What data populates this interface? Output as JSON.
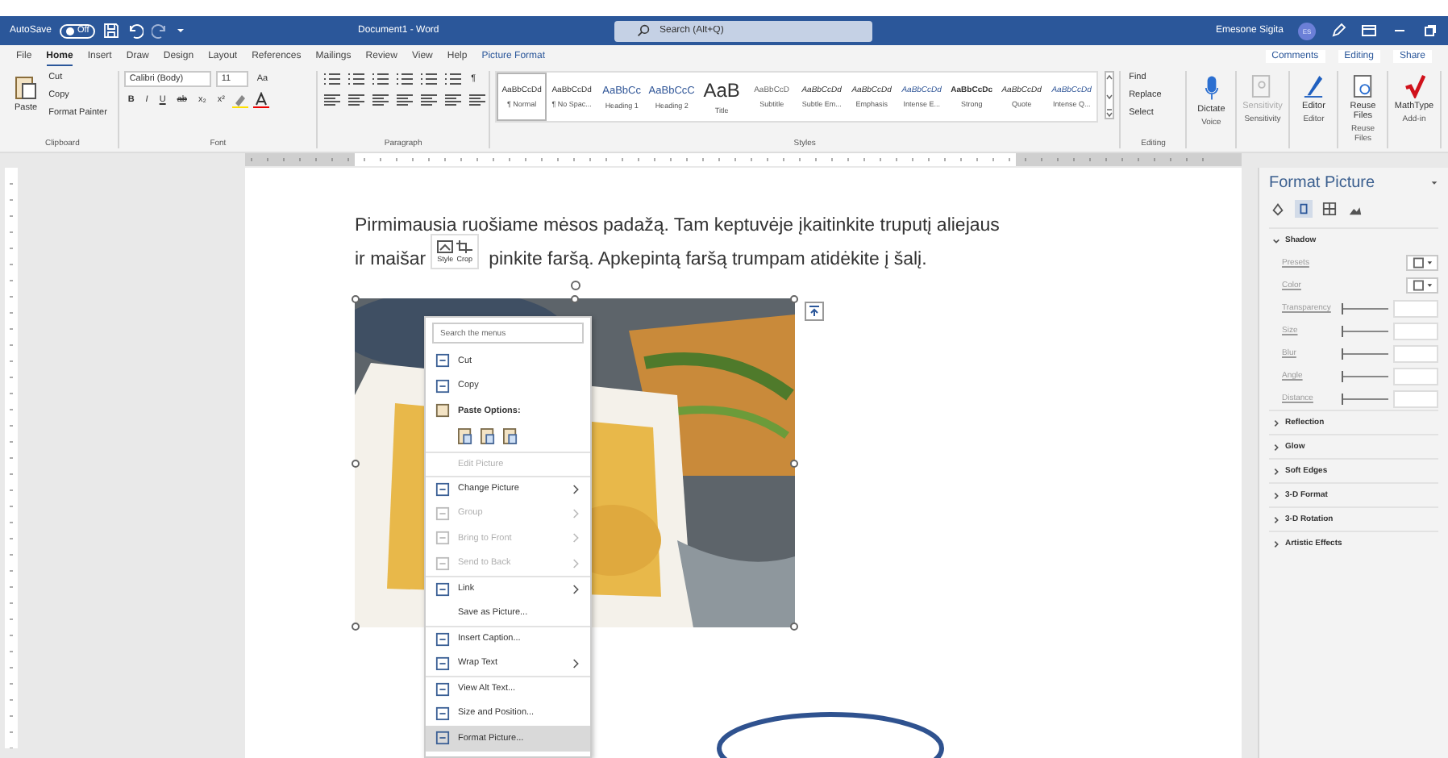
{
  "title_bar": {
    "autosave_label": "AutoSave",
    "autosave_on": false,
    "autosave_state": "Off",
    "document_title": "Document1 - Word",
    "search_placeholder": "Search (Alt+Q)",
    "user_name": "Emesone Sigita",
    "user_initials": "ES"
  },
  "tabs": [
    {
      "label": "File",
      "selected": false
    },
    {
      "label": "Home",
      "selected": true
    },
    {
      "label": "Insert",
      "selected": false
    },
    {
      "label": "Draw",
      "selected": false
    },
    {
      "label": "Design",
      "selected": false
    },
    {
      "label": "Layout",
      "selected": false
    },
    {
      "label": "References",
      "selected": false
    },
    {
      "label": "Mailings",
      "selected": false
    },
    {
      "label": "Review",
      "selected": false
    },
    {
      "label": "View",
      "selected": false
    },
    {
      "label": "Help",
      "selected": false
    },
    {
      "label": "Picture Format",
      "selected": false,
      "kind": "contextual"
    }
  ],
  "actions": {
    "comments": "Comments",
    "editing": "Editing",
    "share": "Share"
  },
  "ribbon": {
    "clipboard": {
      "paste": "Paste",
      "cut": "Cut",
      "copy": "Copy",
      "format_painter": "Format Painter",
      "label": "Clipboard"
    },
    "font": {
      "name": "Calibri (Body)",
      "size": "11",
      "case": "Aa",
      "format_buttons": [
        "B",
        "I",
        "U",
        "ab",
        "x₂",
        "x²"
      ],
      "label": "Font"
    },
    "paragraph": {
      "pilcrow": "¶",
      "label": "Paragraph"
    },
    "styles": {
      "items": [
        {
          "preview": "AaBbCcDd",
          "name": "¶ Normal",
          "selected": true,
          "kind": "normal"
        },
        {
          "preview": "AaBbCcDd",
          "name": "¶ No Spac...",
          "selected": false,
          "kind": "normal"
        },
        {
          "preview": "AaBbCc",
          "name": "Heading 1",
          "selected": false,
          "kind": "heading"
        },
        {
          "preview": "AaBbCcC",
          "name": "Heading 2",
          "selected": false,
          "kind": "heading"
        },
        {
          "preview": "AaB",
          "name": "Title",
          "selected": false,
          "kind": "title"
        },
        {
          "preview": "AaBbCcD",
          "name": "Subtitle",
          "selected": false,
          "kind": "subtitle"
        },
        {
          "preview": "AaBbCcDd",
          "name": "Subtle Em...",
          "selected": false,
          "kind": "emphasis"
        },
        {
          "preview": "AaBbCcDd",
          "name": "Emphasis",
          "selected": false,
          "kind": "emphasis"
        },
        {
          "preview": "AaBbCcDd",
          "name": "Intense E...",
          "selected": false,
          "kind": "intense"
        },
        {
          "preview": "AaBbCcDc",
          "name": "Strong",
          "selected": false,
          "kind": "strong"
        },
        {
          "preview": "AaBbCcDd",
          "name": "Quote",
          "selected": false,
          "kind": "emphasis"
        },
        {
          "preview": "AaBbCcDd",
          "name": "Intense Q...",
          "selected": false,
          "kind": "intense"
        }
      ],
      "label": "Styles"
    },
    "editing": {
      "find": "Find",
      "replace": "Replace",
      "select": "Select",
      "label": "Editing"
    },
    "voice": {
      "button": "Dictate",
      "label": "Voice"
    },
    "sensitivity": {
      "button": "Sensitivity",
      "label": "Sensitivity",
      "disabled": true
    },
    "editor": {
      "button": "Editor",
      "label": "Editor"
    },
    "reuse": {
      "button": "Reuse Files",
      "label": "Reuse Files"
    },
    "addin": {
      "button": "MathType",
      "label": "Add-in"
    }
  },
  "document": {
    "line_1": "Pirmimausia ruošiame mėsos padažą. Tam keptuvėje įkaitinkite truputį aliejaus",
    "line_2_start": "ir maišar",
    "line_2_end": "pinkite faršą. Apkepintą faršą trumpam atidėkite į šalį."
  },
  "mini_toolbar": {
    "style": "Style",
    "crop": "Crop"
  },
  "context_menu": {
    "search_placeholder": "Search the menus",
    "items": [
      {
        "kind": "item",
        "label": "Cut",
        "disabled": false,
        "submenu": false,
        "selected": false,
        "has_icon": true
      },
      {
        "kind": "item",
        "label": "Copy",
        "disabled": false,
        "submenu": false,
        "selected": false,
        "has_icon": true
      },
      {
        "kind": "header",
        "label": "Paste Options:",
        "disabled": false,
        "submenu": false,
        "selected": false,
        "has_icon": true
      },
      {
        "kind": "paste-options"
      },
      {
        "kind": "item",
        "label": "Edit Picture",
        "disabled": true,
        "submenu": false,
        "selected": false,
        "has_icon": false
      },
      {
        "kind": "item",
        "label": "Change Picture",
        "disabled": false,
        "submenu": true,
        "selected": false,
        "has_icon": true
      },
      {
        "kind": "item",
        "label": "Group",
        "disabled": true,
        "submenu": true,
        "selected": false,
        "has_icon": true
      },
      {
        "kind": "item",
        "label": "Bring to Front",
        "disabled": true,
        "submenu": true,
        "selected": false,
        "has_icon": true
      },
      {
        "kind": "item",
        "label": "Send to Back",
        "disabled": true,
        "submenu": true,
        "selected": false,
        "has_icon": true
      },
      {
        "kind": "item",
        "label": "Link",
        "disabled": false,
        "submenu": true,
        "selected": false,
        "has_icon": true
      },
      {
        "kind": "item",
        "label": "Save as Picture...",
        "disabled": false,
        "submenu": false,
        "selected": false,
        "has_icon": false
      },
      {
        "kind": "item",
        "label": "Insert Caption...",
        "disabled": false,
        "submenu": false,
        "selected": false,
        "has_icon": true
      },
      {
        "kind": "item",
        "label": "Wrap Text",
        "disabled": false,
        "submenu": true,
        "selected": false,
        "has_icon": true
      },
      {
        "kind": "item",
        "label": "View Alt Text...",
        "disabled": false,
        "submenu": false,
        "selected": false,
        "has_icon": true
      },
      {
        "kind": "item",
        "label": "Size and Position...",
        "disabled": false,
        "submenu": false,
        "selected": false,
        "has_icon": true
      },
      {
        "kind": "item",
        "label": "Format Picture...",
        "disabled": false,
        "submenu": false,
        "selected": true,
        "has_icon": true
      }
    ]
  },
  "format_pane": {
    "title": "Format Picture",
    "icon_tabs": [
      {
        "selected": false
      },
      {
        "selected": true
      },
      {
        "selected": false
      },
      {
        "selected": false
      }
    ],
    "sections": [
      {
        "label": "Shadow",
        "expanded": true,
        "rows": [
          {
            "label": "Presets",
            "kind": "dropdown",
            "disabled": true
          },
          {
            "label": "Color",
            "kind": "dropdown",
            "disabled": true
          },
          {
            "label": "Transparency",
            "kind": "slider",
            "disabled": true,
            "level": 0
          },
          {
            "label": "Size",
            "kind": "slider",
            "disabled": true,
            "level": 0
          },
          {
            "label": "Blur",
            "kind": "slider",
            "disabled": true,
            "level": 0
          },
          {
            "label": "Angle",
            "kind": "slider",
            "disabled": true,
            "level": 0
          },
          {
            "label": "Distance",
            "kind": "slider",
            "disabled": true,
            "level": 0
          }
        ]
      },
      {
        "label": "Reflection",
        "expanded": false
      },
      {
        "label": "Glow",
        "expanded": false
      },
      {
        "label": "Soft Edges",
        "expanded": false
      },
      {
        "label": "3-D Format",
        "expanded": false
      },
      {
        "label": "3-D Rotation",
        "expanded": false
      },
      {
        "label": "Artistic Effects",
        "expanded": false
      }
    ]
  }
}
